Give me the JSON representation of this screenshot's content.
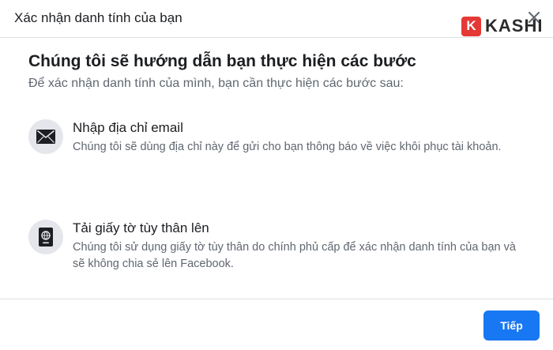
{
  "dialog": {
    "header_title": "Xác nhận danh tính của bạn",
    "main_title": "Chúng tôi sẽ hướng dẫn bạn thực hiện các bước",
    "subtitle": "Để xác nhận danh tính của mình, bạn cần thực hiện các bước sau:",
    "steps": [
      {
        "icon": "envelope-icon",
        "title": "Nhập địa chỉ email",
        "description": "Chúng tôi sẽ dùng địa chỉ này để gửi cho bạn thông báo về việc khôi phục tài khoản."
      },
      {
        "icon": "id-document-icon",
        "title": "Tải giấy tờ tùy thân lên",
        "description": "Chúng tôi sử dụng giấy tờ tùy thân do chính phủ cấp để xác nhận danh tính của bạn và sẽ không chia sẻ lên Facebook."
      }
    ],
    "next_label": "Tiếp"
  },
  "watermark": {
    "mark": "K",
    "text": "KASHI"
  },
  "colors": {
    "primary": "#1877f2",
    "text": "#1c1e21",
    "secondary_text": "#606770",
    "divider": "#dddfe2",
    "icon_bg": "#e4e6eb",
    "brand_red": "#e53935"
  }
}
